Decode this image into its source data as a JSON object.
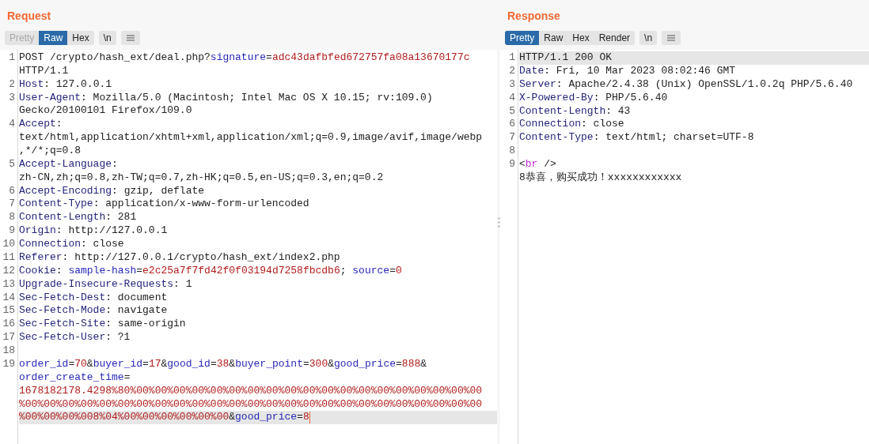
{
  "panels": [
    {
      "title": "Request",
      "tabs": [
        {
          "label": "Pretty",
          "selected": false,
          "disabled": true
        },
        {
          "label": "Raw",
          "selected": true,
          "disabled": false
        },
        {
          "label": "Hex",
          "selected": false,
          "disabled": false
        }
      ],
      "newline_button": "\\n",
      "lines": [
        {
          "number": "1",
          "highlighted": false,
          "cursor": false,
          "wraps": [
            {
              "tokens": [
                {
                  "kind": "plain",
                  "text": "POST /crypto/hash_ext/deal.php?"
                },
                {
                  "kind": "param",
                  "text": "signature"
                },
                {
                  "kind": "plain",
                  "text": "="
                },
                {
                  "kind": "value",
                  "text": "adc43dafbfed672757fa08a13670177c"
                }
              ]
            },
            {
              "tokens": [
                {
                  "kind": "plain",
                  "text": "HTTP/1.1"
                }
              ]
            }
          ]
        },
        {
          "number": "2",
          "highlighted": false,
          "cursor": false,
          "wraps": [
            {
              "tokens": [
                {
                  "kind": "header",
                  "text": "Host"
                },
                {
                  "kind": "plain",
                  "text": ": 127.0.0.1"
                }
              ]
            }
          ]
        },
        {
          "number": "3",
          "highlighted": false,
          "cursor": false,
          "wraps": [
            {
              "tokens": [
                {
                  "kind": "header",
                  "text": "User-Agent"
                },
                {
                  "kind": "plain",
                  "text": ": Mozilla/5.0 (Macintosh; Intel Mac OS X 10.15; rv:109.0)"
                }
              ]
            },
            {
              "tokens": [
                {
                  "kind": "plain",
                  "text": "Gecko/20100101 Firefox/109.0"
                }
              ]
            }
          ]
        },
        {
          "number": "4",
          "highlighted": false,
          "cursor": false,
          "wraps": [
            {
              "tokens": [
                {
                  "kind": "header",
                  "text": "Accept"
                },
                {
                  "kind": "plain",
                  "text": ":"
                }
              ]
            },
            {
              "tokens": [
                {
                  "kind": "plain",
                  "text": "text/html,application/xhtml+xml,application/xml;q=0.9,image/avif,image/webp"
                }
              ]
            },
            {
              "tokens": [
                {
                  "kind": "plain",
                  "text": ",*/*;q=0.8"
                }
              ]
            }
          ]
        },
        {
          "number": "5",
          "highlighted": false,
          "cursor": false,
          "wraps": [
            {
              "tokens": [
                {
                  "kind": "header",
                  "text": "Accept-Language"
                },
                {
                  "kind": "plain",
                  "text": ":"
                }
              ]
            },
            {
              "tokens": [
                {
                  "kind": "plain",
                  "text": "zh-CN,zh;q=0.8,zh-TW;q=0.7,zh-HK;q=0.5,en-US;q=0.3,en;q=0.2"
                }
              ]
            }
          ]
        },
        {
          "number": "6",
          "highlighted": false,
          "cursor": false,
          "wraps": [
            {
              "tokens": [
                {
                  "kind": "header",
                  "text": "Accept-Encoding"
                },
                {
                  "kind": "plain",
                  "text": ": gzip, deflate"
                }
              ]
            }
          ]
        },
        {
          "number": "7",
          "highlighted": false,
          "cursor": false,
          "wraps": [
            {
              "tokens": [
                {
                  "kind": "header",
                  "text": "Content-Type"
                },
                {
                  "kind": "plain",
                  "text": ": application/x-www-form-urlencoded"
                }
              ]
            }
          ]
        },
        {
          "number": "8",
          "highlighted": false,
          "cursor": false,
          "wraps": [
            {
              "tokens": [
                {
                  "kind": "header",
                  "text": "Content-Length"
                },
                {
                  "kind": "plain",
                  "text": ": 281"
                }
              ]
            }
          ]
        },
        {
          "number": "9",
          "highlighted": false,
          "cursor": false,
          "wraps": [
            {
              "tokens": [
                {
                  "kind": "header",
                  "text": "Origin"
                },
                {
                  "kind": "plain",
                  "text": ": http://127.0.0.1"
                }
              ]
            }
          ]
        },
        {
          "number": "10",
          "highlighted": false,
          "cursor": false,
          "wraps": [
            {
              "tokens": [
                {
                  "kind": "header",
                  "text": "Connection"
                },
                {
                  "kind": "plain",
                  "text": ": close"
                }
              ]
            }
          ]
        },
        {
          "number": "11",
          "highlighted": false,
          "cursor": false,
          "wraps": [
            {
              "tokens": [
                {
                  "kind": "header",
                  "text": "Referer"
                },
                {
                  "kind": "plain",
                  "text": ": http://127.0.0.1/crypto/hash_ext/index2.php"
                }
              ]
            }
          ]
        },
        {
          "number": "12",
          "highlighted": false,
          "cursor": false,
          "wraps": [
            {
              "tokens": [
                {
                  "kind": "header",
                  "text": "Cookie"
                },
                {
                  "kind": "plain",
                  "text": ": "
                },
                {
                  "kind": "param",
                  "text": "sample-hash"
                },
                {
                  "kind": "plain",
                  "text": "="
                },
                {
                  "kind": "value",
                  "text": "e2c25a7f7fd42f0f03194d7258fbcdb6"
                },
                {
                  "kind": "plain",
                  "text": "; "
                },
                {
                  "kind": "param",
                  "text": "source"
                },
                {
                  "kind": "plain",
                  "text": "="
                },
                {
                  "kind": "value",
                  "text": "0"
                }
              ]
            }
          ]
        },
        {
          "number": "13",
          "highlighted": false,
          "cursor": false,
          "wraps": [
            {
              "tokens": [
                {
                  "kind": "header",
                  "text": "Upgrade-Insecure-Requests"
                },
                {
                  "kind": "plain",
                  "text": ": 1"
                }
              ]
            }
          ]
        },
        {
          "number": "14",
          "highlighted": false,
          "cursor": false,
          "wraps": [
            {
              "tokens": [
                {
                  "kind": "header",
                  "text": "Sec-Fetch-Dest"
                },
                {
                  "kind": "plain",
                  "text": ": document"
                }
              ]
            }
          ]
        },
        {
          "number": "15",
          "highlighted": false,
          "cursor": false,
          "wraps": [
            {
              "tokens": [
                {
                  "kind": "header",
                  "text": "Sec-Fetch-Mode"
                },
                {
                  "kind": "plain",
                  "text": ": navigate"
                }
              ]
            }
          ]
        },
        {
          "number": "16",
          "highlighted": false,
          "cursor": false,
          "wraps": [
            {
              "tokens": [
                {
                  "kind": "header",
                  "text": "Sec-Fetch-Site"
                },
                {
                  "kind": "plain",
                  "text": ": same-origin"
                }
              ]
            }
          ]
        },
        {
          "number": "17",
          "highlighted": false,
          "cursor": false,
          "wraps": [
            {
              "tokens": [
                {
                  "kind": "header",
                  "text": "Sec-Fetch-User"
                },
                {
                  "kind": "plain",
                  "text": ": ?1"
                }
              ]
            }
          ]
        },
        {
          "number": "18",
          "highlighted": false,
          "cursor": false
        },
        {
          "number": "19",
          "highlighted": true,
          "cursor": true,
          "wraps": [
            {
              "tokens": [
                {
                  "kind": "param",
                  "text": "order_id"
                },
                {
                  "kind": "plain",
                  "text": "="
                },
                {
                  "kind": "value",
                  "text": "70"
                },
                {
                  "kind": "plain",
                  "text": "&"
                },
                {
                  "kind": "param",
                  "text": "buyer_id"
                },
                {
                  "kind": "plain",
                  "text": "="
                },
                {
                  "kind": "value",
                  "text": "17"
                },
                {
                  "kind": "plain",
                  "text": "&"
                },
                {
                  "kind": "param",
                  "text": "good_id"
                },
                {
                  "kind": "plain",
                  "text": "="
                },
                {
                  "kind": "value",
                  "text": "38"
                },
                {
                  "kind": "plain",
                  "text": "&"
                },
                {
                  "kind": "param",
                  "text": "buyer_point"
                },
                {
                  "kind": "plain",
                  "text": "="
                },
                {
                  "kind": "value",
                  "text": "300"
                },
                {
                  "kind": "plain",
                  "text": "&"
                },
                {
                  "kind": "param",
                  "text": "good_price"
                },
                {
                  "kind": "plain",
                  "text": "="
                },
                {
                  "kind": "value",
                  "text": "888"
                },
                {
                  "kind": "plain",
                  "text": "&"
                }
              ]
            },
            {
              "tokens": [
                {
                  "kind": "param",
                  "text": "order_create_time"
                },
                {
                  "kind": "plain",
                  "text": "="
                }
              ]
            },
            {
              "tokens": [
                {
                  "kind": "value",
                  "text": "1678182178.4298%80%00%00%00%00%00%00%00%00%00%00%00%00%00%00%00%00%00%00%00"
                }
              ]
            },
            {
              "tokens": [
                {
                  "kind": "value",
                  "text": "%00%00%00%00%00%00%00%00%00%00%00%00%00%00%00%00%00%00%00%00%00%00%00%00%00"
                }
              ]
            },
            {
              "tokens": [
                {
                  "kind": "value",
                  "text": "%00%00%00%008%04%00%00%00%00%00%00"
                },
                {
                  "kind": "plain",
                  "text": "&"
                },
                {
                  "kind": "param",
                  "text": "good_price"
                },
                {
                  "kind": "plain",
                  "text": "="
                },
                {
                  "kind": "value",
                  "text": "8"
                }
              ]
            }
          ]
        }
      ]
    },
    {
      "title": "Response",
      "tabs": [
        {
          "label": "Pretty",
          "selected": true,
          "disabled": false
        },
        {
          "label": "Raw",
          "selected": false,
          "disabled": false
        },
        {
          "label": "Hex",
          "selected": false,
          "disabled": false
        },
        {
          "label": "Render",
          "selected": false,
          "disabled": false
        }
      ],
      "newline_button": "\\n",
      "lines": [
        {
          "number": "1",
          "highlighted": true,
          "cursor": false,
          "wraps": [
            {
              "tokens": [
                {
                  "kind": "plain",
                  "text": "HTTP/1.1 200 OK"
                }
              ]
            }
          ]
        },
        {
          "number": "2",
          "highlighted": false,
          "cursor": false,
          "wraps": [
            {
              "tokens": [
                {
                  "kind": "header",
                  "text": "Date"
                },
                {
                  "kind": "plain",
                  "text": ": Fri, 10 Mar 2023 08:02:46 GMT"
                }
              ]
            }
          ]
        },
        {
          "number": "3",
          "highlighted": false,
          "cursor": false,
          "wraps": [
            {
              "tokens": [
                {
                  "kind": "header",
                  "text": "Server"
                },
                {
                  "kind": "plain",
                  "text": ": Apache/2.4.38 (Unix) OpenSSL/1.0.2q PHP/5.6.40"
                }
              ]
            }
          ]
        },
        {
          "number": "4",
          "highlighted": false,
          "cursor": false,
          "wraps": [
            {
              "tokens": [
                {
                  "kind": "header",
                  "text": "X-Powered-By"
                },
                {
                  "kind": "plain",
                  "text": ": PHP/5.6.40"
                }
              ]
            }
          ]
        },
        {
          "number": "5",
          "highlighted": false,
          "cursor": false,
          "wraps": [
            {
              "tokens": [
                {
                  "kind": "header",
                  "text": "Content-Length"
                },
                {
                  "kind": "plain",
                  "text": ": 43"
                }
              ]
            }
          ]
        },
        {
          "number": "6",
          "highlighted": false,
          "cursor": false,
          "wraps": [
            {
              "tokens": [
                {
                  "kind": "header",
                  "text": "Connection"
                },
                {
                  "kind": "plain",
                  "text": ": close"
                }
              ]
            }
          ]
        },
        {
          "number": "7",
          "highlighted": false,
          "cursor": false,
          "wraps": [
            {
              "tokens": [
                {
                  "kind": "header",
                  "text": "Content-Type"
                },
                {
                  "kind": "plain",
                  "text": ": text/html; charset=UTF-8"
                }
              ]
            }
          ]
        },
        {
          "number": "8",
          "highlighted": false,
          "cursor": false
        },
        {
          "number": "9",
          "highlighted": false,
          "cursor": false,
          "wraps": [
            {
              "tokens": [
                {
                  "kind": "plain",
                  "text": "<"
                },
                {
                  "kind": "tag",
                  "text": "br"
                },
                {
                  "kind": "plain",
                  "text": " />"
                }
              ]
            },
            {
              "tokens": [
                {
                  "kind": "plain",
                  "text": "8恭喜，购买成功！xxxxxxxxxxxx"
                }
              ]
            }
          ]
        }
      ]
    }
  ]
}
